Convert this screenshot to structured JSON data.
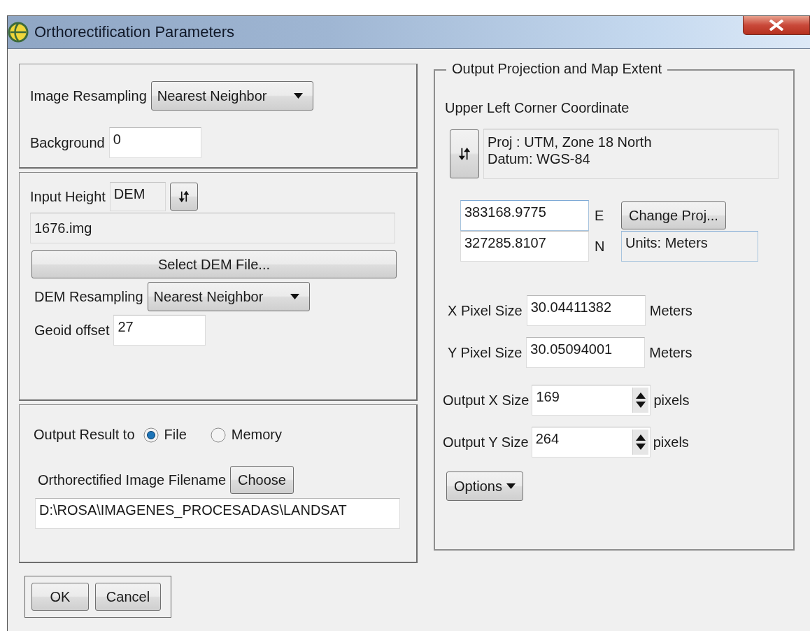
{
  "window": {
    "title": "Orthorectification Parameters"
  },
  "image_resampling": {
    "label": "Image Resampling",
    "value": "Nearest Neighbor"
  },
  "background": {
    "label": "Background",
    "value": "0"
  },
  "input_height": {
    "label": "Input Height",
    "value": "DEM"
  },
  "dem_file": {
    "value": "1676.img",
    "button": "Select DEM File..."
  },
  "dem_resampling": {
    "label": "DEM Resampling",
    "value": "Nearest Neighbor"
  },
  "geoid_offset": {
    "label": "Geoid offset",
    "value": "27"
  },
  "output_result": {
    "label": "Output Result to",
    "options": [
      {
        "label": "File",
        "selected": true
      },
      {
        "label": "Memory",
        "selected": false
      }
    ]
  },
  "filename": {
    "label": "Orthorectified Image Filename",
    "button": "Choose",
    "value": "D:\\ROSA\\IMAGENES_PROCESADAS\\LANDSAT"
  },
  "output_projection": {
    "title": "Output Projection and Map Extent",
    "subtitle": "Upper Left Corner Coordinate",
    "projection_lines": [
      "Proj : UTM, Zone 18 North",
      "Datum: WGS-84"
    ],
    "coordinates": [
      {
        "value": "383168.9775",
        "unit": "E"
      },
      {
        "value": "327285.8107",
        "unit": "N"
      }
    ],
    "change_proj_button": "Change Proj...",
    "units": "Units: Meters",
    "pixel_sizes": [
      {
        "label": "X Pixel Size",
        "value": "30.04411382",
        "unit": "Meters"
      },
      {
        "label": "Y Pixel Size",
        "value": "30.05094001",
        "unit": "Meters"
      }
    ],
    "output_sizes": [
      {
        "label": "Output X Size",
        "value": "169",
        "unit": "pixels"
      },
      {
        "label": "Output Y Size",
        "value": "264",
        "unit": "pixels"
      }
    ],
    "options_button": "Options"
  },
  "buttons": [
    "OK",
    "Cancel"
  ]
}
